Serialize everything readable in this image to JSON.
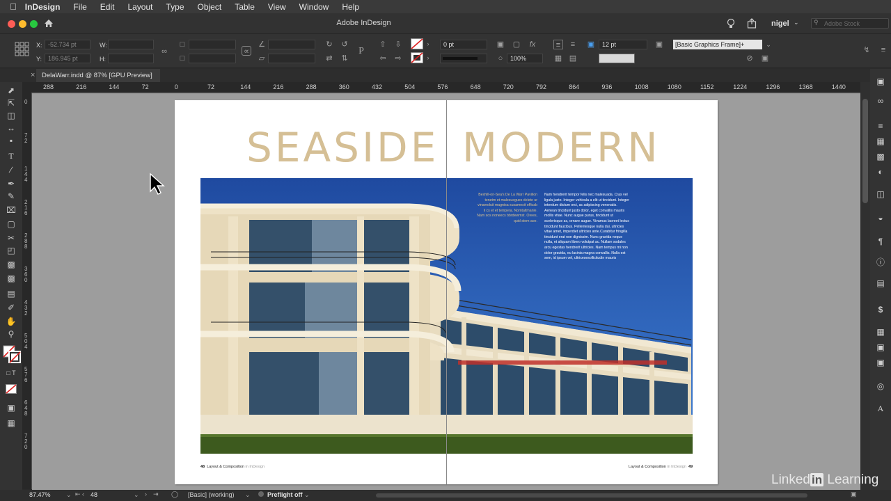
{
  "menubar": {
    "app": "InDesign",
    "items": [
      "File",
      "Edit",
      "Layout",
      "Type",
      "Object",
      "Table",
      "View",
      "Window",
      "Help"
    ]
  },
  "titlebar": {
    "title": "Adobe InDesign",
    "user": "nigel",
    "stock_search_placeholder": "Adobe Stock"
  },
  "control": {
    "x_label": "X:",
    "x_value": "-52.734 pt",
    "y_label": "Y:",
    "y_value": "186.945 pt",
    "w_label": "W:",
    "h_label": "H:",
    "stroke_weight": "0 pt",
    "opacity": "100%",
    "corner_size": "12 pt",
    "object_style": "[Basic Graphics Frame]+"
  },
  "document_tab": {
    "label": "DelaWarr.indd @ 87% [GPU Preview]",
    "close": "×"
  },
  "ruler_h": [
    "288",
    "216",
    "144",
    "72",
    "0",
    "72",
    "144",
    "216",
    "288",
    "360",
    "432",
    "504",
    "576",
    "648",
    "720",
    "792",
    "864",
    "936",
    "1008",
    "1080",
    "1152",
    "1224",
    "1296",
    "1368",
    "1440"
  ],
  "ruler_v": [
    "0",
    "7\n2",
    "1\n4\n4",
    "2\n1\n6",
    "2\n8\n8",
    "3\n6\n0",
    "4\n3\n2",
    "5\n0\n4",
    "5\n7\n6",
    "6\n4\n8",
    "7\n2\n0"
  ],
  "spread": {
    "title_left": "SEASIDE",
    "title_right": "MODERN",
    "caption_left": "Bexhill-on-Sea's De La Warr Pavilion tenetm et malesuegues delete ur vinamoluit magnisa susamnsit officab il cs et et tempera. Nomtaltmanle. Nam sos noneecs bbrdewmst. Orees, quid stem aoe.",
    "caption_right": "Nam hendrerit tempor felis nec malesuada. Cras vel ligula justo. Integer vehicula a elit ut tincidunt. Integer interdum dictum orci, ac adipiscing venenatis. Aenean tincidunt justo dolor, eget convallis mauris mollis vitae. Nunc augue purus, tincidunt ut scelerisque ac, ornare augue. Vivamus laoreet lectus tincidunt faucibus. Pellentesque nulla dui, ultricies vitae amet, imperdiet ultricies ante.Curabitur fringilla tincidunt erat non dignissim. Nunc gravida neque nulla, et aliquam libero volutpat ac. Nullam sodales arcu egestas hendrerit ultricies. Nam tempus mi non dolor gravida, eu lacinia magna convallis. Nulla est sem, id ipsum vel, ultricesesollicitudin mauris",
    "folio_left_num": "48",
    "folio_left_text": "Layout & Composition",
    "folio_left_sub": "in InDesign",
    "folio_right_text": "Layout & Composition",
    "folio_right_sub": "in InDesign",
    "folio_right_num": "49"
  },
  "status": {
    "zoom": "87.47%",
    "page": "48",
    "profile": "[Basic] (working)",
    "preflight": "Preflight off"
  },
  "watermark": {
    "linked": "Linked",
    "in": "in",
    "learning": "Learning"
  },
  "colors": {
    "title_tan": "#d5bf95",
    "sky_top": "#1f4da0",
    "sky_bottom": "#3d7ad0",
    "building": "#ece0c4",
    "grass": "#3d5a1e"
  }
}
